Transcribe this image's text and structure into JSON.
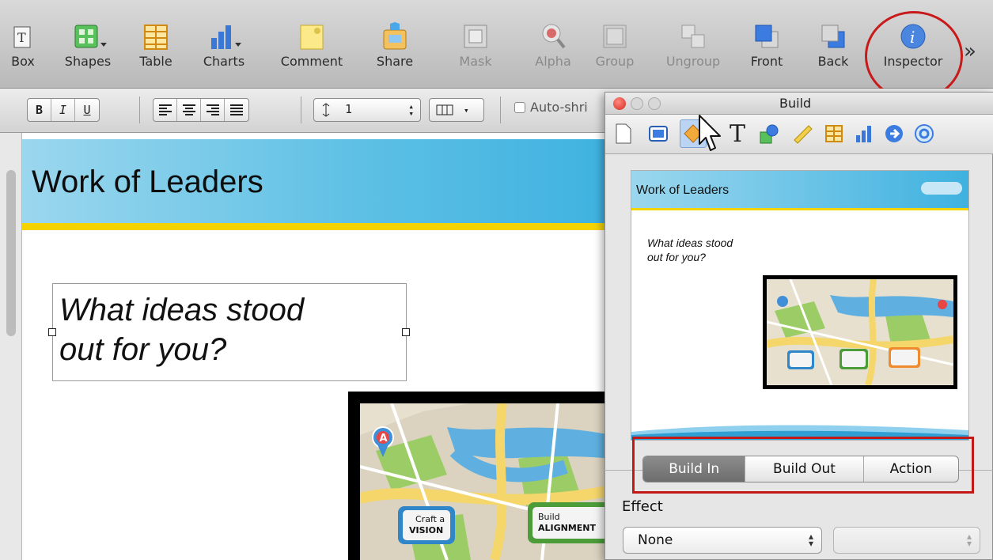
{
  "toolbar": {
    "items": [
      {
        "label": "Box",
        "icon": "text-box-icon"
      },
      {
        "label": "Shapes",
        "icon": "shapes-icon"
      },
      {
        "label": "Table",
        "icon": "table-icon"
      },
      {
        "label": "Charts",
        "icon": "charts-icon"
      },
      {
        "label": "Comment",
        "icon": "comment-icon"
      },
      {
        "label": "Share",
        "icon": "share-icon"
      },
      {
        "label": "Mask",
        "icon": "mask-icon"
      },
      {
        "label": "Alpha",
        "icon": "alpha-icon"
      },
      {
        "label": "Group",
        "icon": "group-icon"
      },
      {
        "label": "Ungroup",
        "icon": "ungroup-icon"
      },
      {
        "label": "Front",
        "icon": "front-icon"
      },
      {
        "label": "Back",
        "icon": "back-icon"
      },
      {
        "label": "Inspector",
        "icon": "inspector-icon"
      }
    ],
    "overflow": "»"
  },
  "formatbar": {
    "bold": "B",
    "italic": "I",
    "underline": "U",
    "line_spacing_value": "1",
    "auto_shrink_label": "Auto-shri"
  },
  "slide": {
    "title": "Work of Leaders",
    "body_line1": "What ideas stood",
    "body_line2": "out for you?",
    "map_pin_a": "A",
    "map_sign1_line1": "Craft a",
    "map_sign1_line2": "VISION",
    "map_sign2_line1": "Build",
    "map_sign2_line2": "ALIGNMENT"
  },
  "panel": {
    "title": "Build",
    "preview_title": "Work of Leaders",
    "preview_line1": "What ideas stood",
    "preview_line2": "out for you?",
    "tabs": [
      "Build In",
      "Build Out",
      "Action"
    ],
    "active_tab": "Build In",
    "effect_label": "Effect",
    "effect_value": "None"
  },
  "colors": {
    "header_blue": "#3fb2e0",
    "header_yellow": "#f5d300",
    "highlight_red": "#c31818"
  }
}
